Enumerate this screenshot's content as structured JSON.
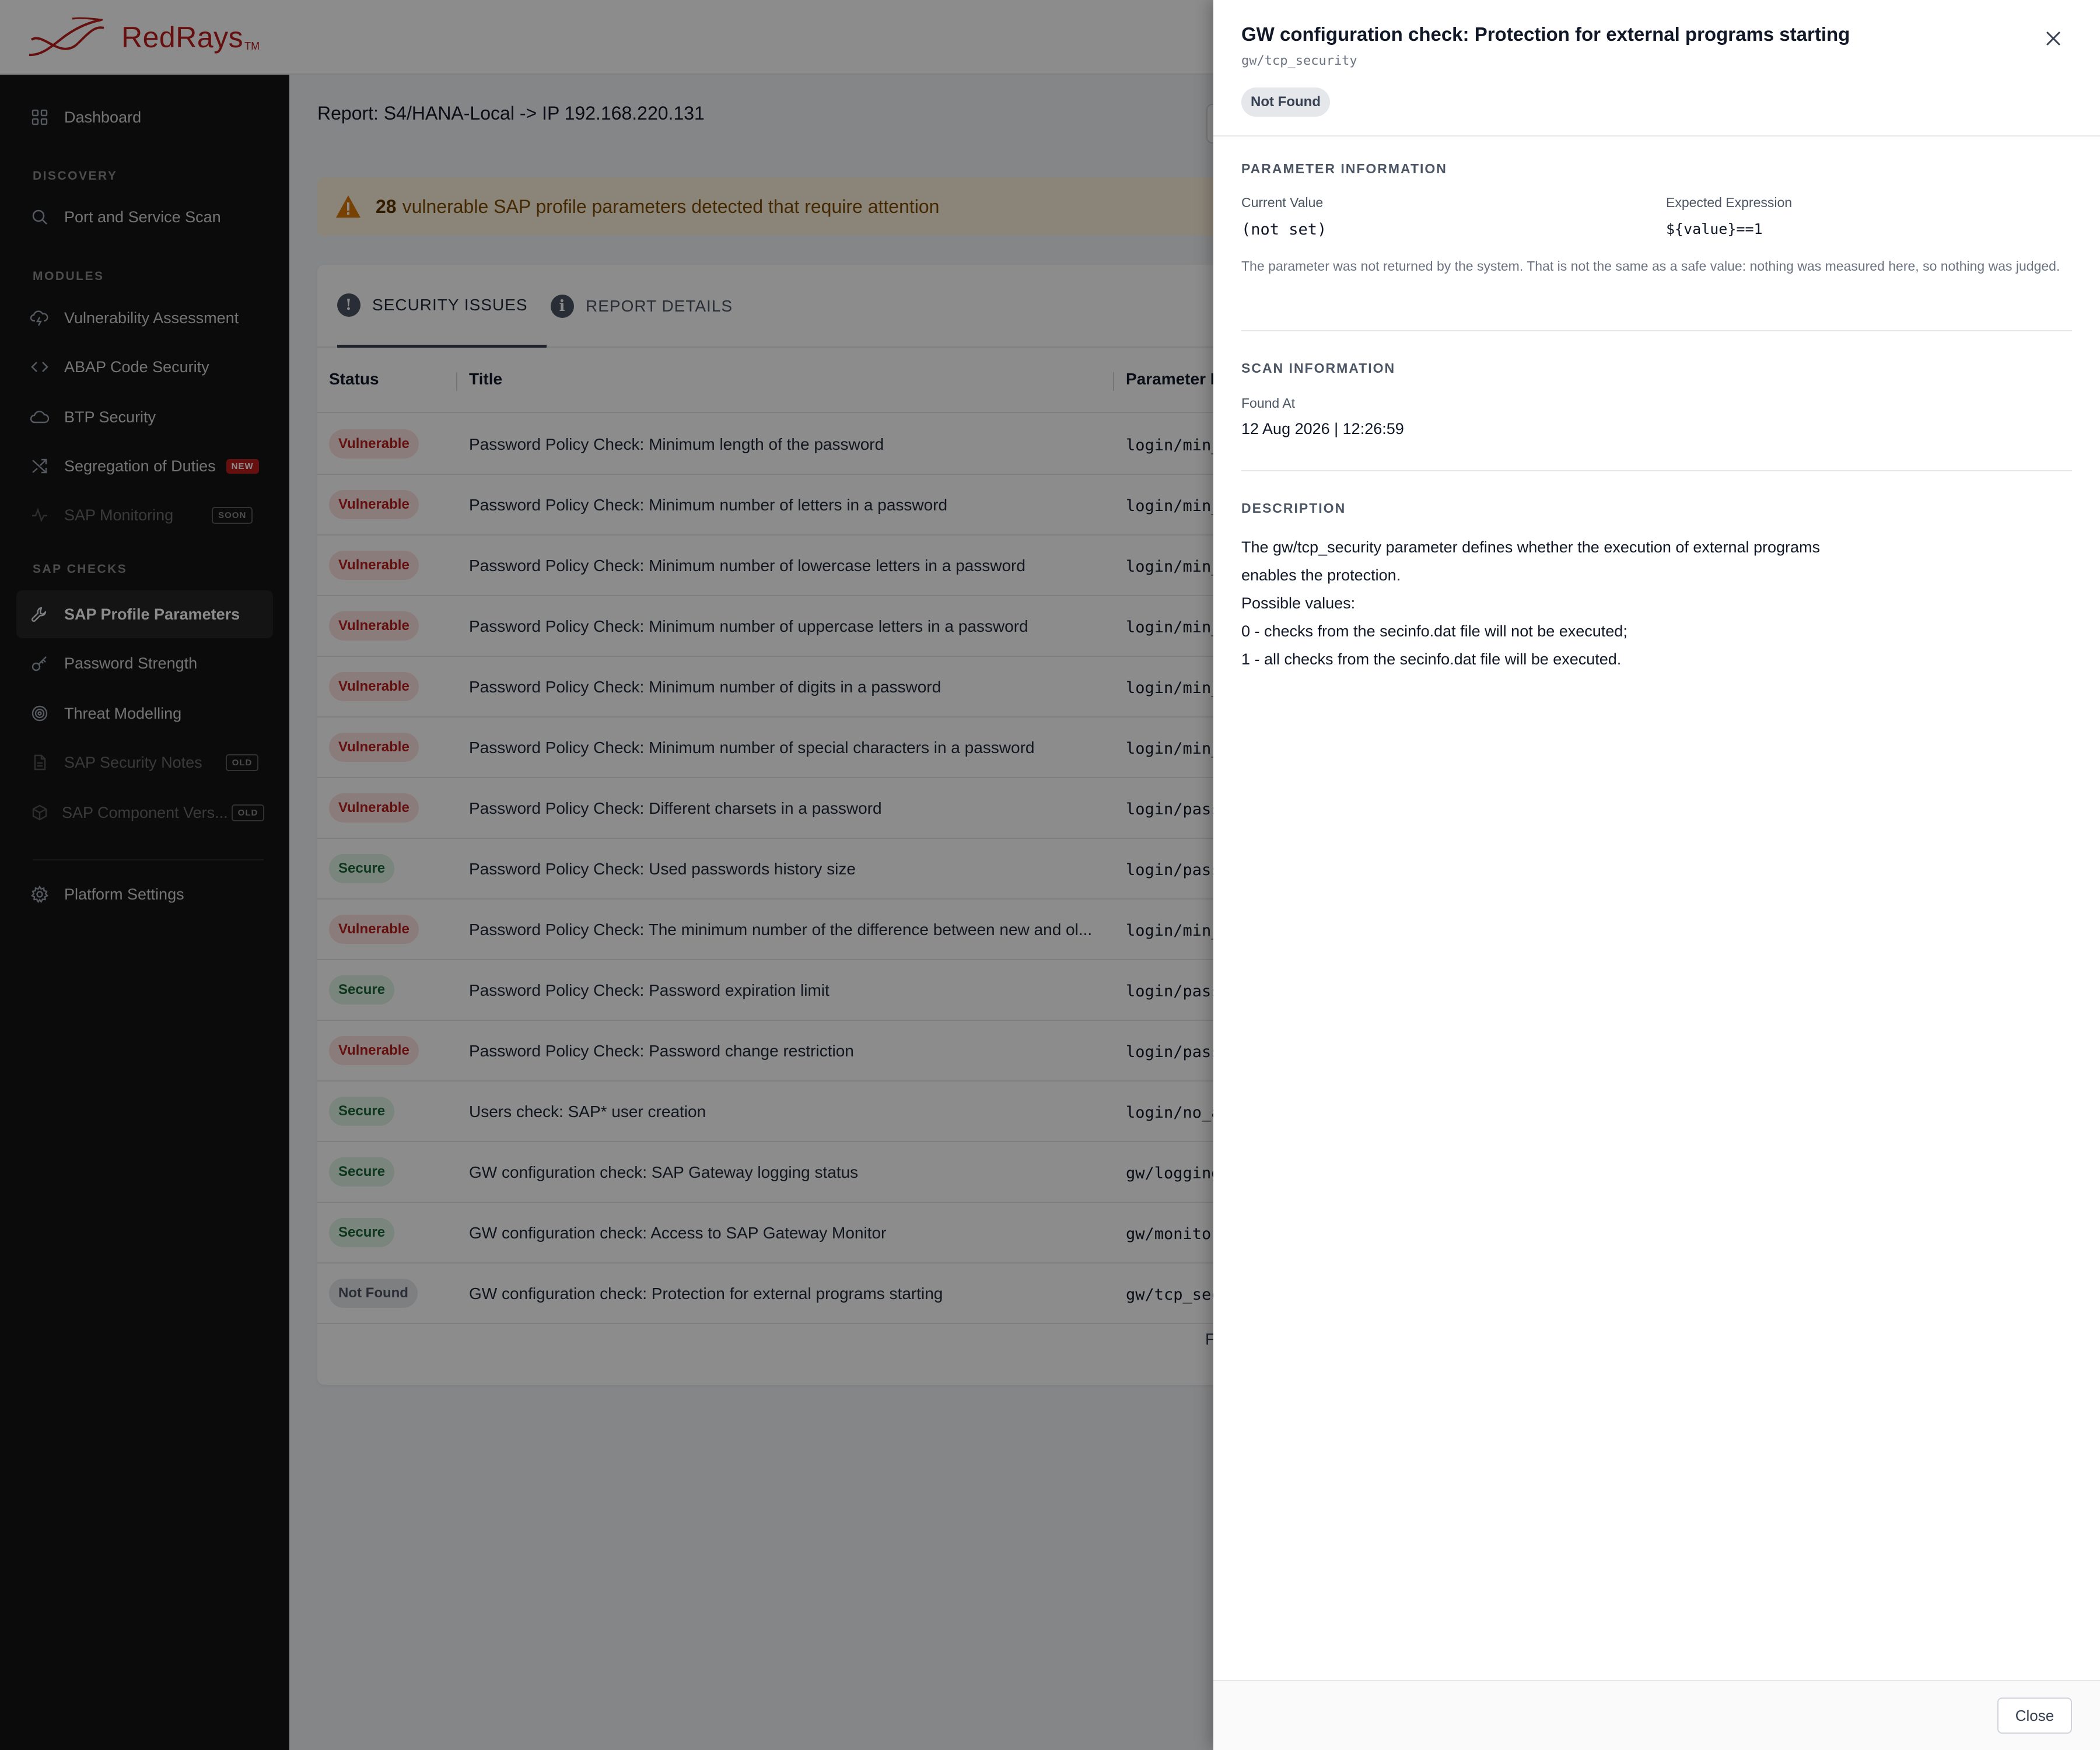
{
  "brand": {
    "name": "RedRays",
    "tm": "TM"
  },
  "nav": {
    "dashboard": "Dashboard",
    "discovery_section": "DISCOVERY",
    "port_scan": "Port and Service Scan",
    "modules_section": "MODULES",
    "vuln_assessment": "Vulnerability Assessment",
    "abap_security": "ABAP Code Security",
    "btp_security": "BTP Security",
    "sod": "Segregation of Duties",
    "sod_badge": "NEW",
    "sap_monitoring": "SAP Monitoring",
    "sap_monitoring_badge": "SOON",
    "sap_checks_section": "SAP CHECKS",
    "profile_params": "SAP Profile Parameters",
    "password_strength": "Password Strength",
    "threat_modelling": "Threat Modelling",
    "security_notes": "SAP Security Notes",
    "security_notes_badge": "OLD",
    "component_versions": "SAP Component Vers...",
    "component_versions_badge": "OLD",
    "platform_settings": "Platform Settings"
  },
  "report": {
    "title": "Report: S4/HANA-Local -> IP 192.168.220.131",
    "alert_count": "28",
    "alert_text": "vulnerable SAP profile parameters detected that require attention"
  },
  "tabs": {
    "security_issues": "SECURITY ISSUES",
    "report_details": "REPORT DETAILS"
  },
  "table": {
    "col_status": "Status",
    "col_title": "Title",
    "col_param": "Parameter N",
    "rows": [
      {
        "status": "Vulnerable",
        "title": "Password Policy Check: Minimum length of the password",
        "param": "login/min_"
      },
      {
        "status": "Vulnerable",
        "title": "Password Policy Check: Minimum number of letters in a password",
        "param": "login/min_"
      },
      {
        "status": "Vulnerable",
        "title": "Password Policy Check: Minimum number of lowercase letters in a password",
        "param": "login/min_"
      },
      {
        "status": "Vulnerable",
        "title": "Password Policy Check: Minimum number of uppercase letters in a password",
        "param": "login/min_"
      },
      {
        "status": "Vulnerable",
        "title": "Password Policy Check: Minimum number of digits in a password",
        "param": "login/min_"
      },
      {
        "status": "Vulnerable",
        "title": "Password Policy Check: Minimum number of special characters in a password",
        "param": "login/min_"
      },
      {
        "status": "Vulnerable",
        "title": "Password Policy Check: Different charsets in a password",
        "param": "login/pass"
      },
      {
        "status": "Secure",
        "title": "Password Policy Check: Used passwords history size",
        "param": "login/pass"
      },
      {
        "status": "Vulnerable",
        "title": "Password Policy Check: The minimum number of the difference between new and ol...",
        "param": "login/min_"
      },
      {
        "status": "Secure",
        "title": "Password Policy Check: Password expiration limit",
        "param": "login/pass"
      },
      {
        "status": "Vulnerable",
        "title": "Password Policy Check: Password change restriction",
        "param": "login/pass"
      },
      {
        "status": "Secure",
        "title": "Users check: SAP* user creation",
        "param": "login/no_a"
      },
      {
        "status": "Secure",
        "title": "GW configuration check: SAP Gateway logging status",
        "param": "gw/logging"
      },
      {
        "status": "Secure",
        "title": "GW configuration check: Access to SAP Gateway Monitor",
        "param": "gw/monitor"
      },
      {
        "status": "Not Found",
        "title": "GW configuration check: Protection for external programs starting",
        "param": "gw/tcp_sec"
      }
    ],
    "pager_char": "F"
  },
  "drawer": {
    "title": "GW configuration check: Protection for external programs starting",
    "subtitle": "gw/tcp_security",
    "status": "Not Found",
    "param_section": "PARAMETER INFORMATION",
    "current_label": "Current Value",
    "current_value": "(not set)",
    "expected_label": "Expected Expression",
    "expected_value": "${value}==1",
    "note": "The parameter was not returned by the system. That is not the same as a safe value: nothing was measured here, so nothing was judged.",
    "scan_section": "SCAN INFORMATION",
    "found_label": "Found At",
    "found_value": "12 Aug 2026 | 12:26:59",
    "desc_section": "DESCRIPTION",
    "desc_lines": [
      "The gw/tcp_security parameter defines whether the execution of external programs",
      "enables the protection.",
      "Possible values:",
      "0 - checks from the secinfo.dat file will not be executed;",
      "1 - all checks from the secinfo.dat file will be executed."
    ],
    "close_label": "Close"
  }
}
